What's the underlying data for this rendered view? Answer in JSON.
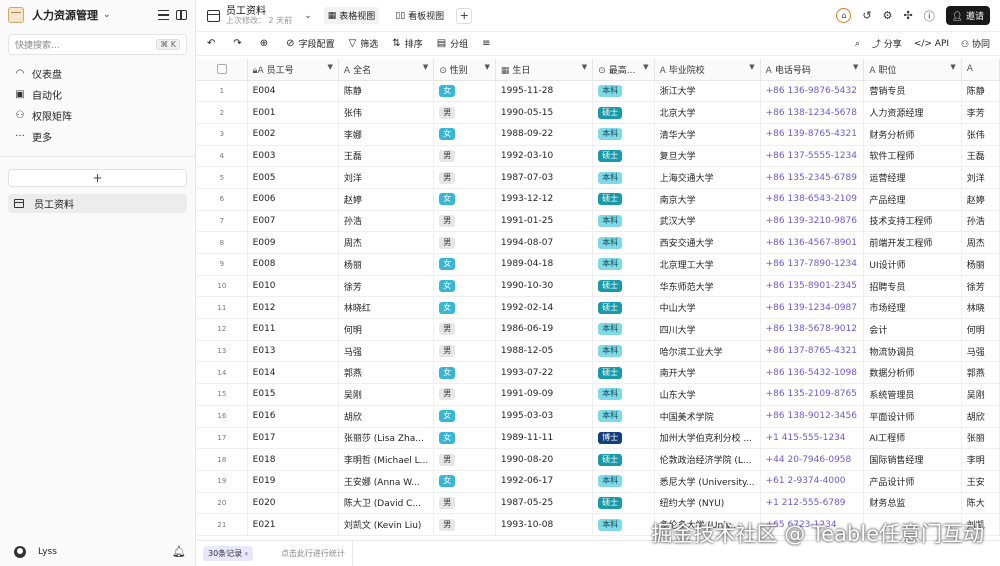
{
  "sidebar": {
    "app_title": "人力资源管理",
    "search_placeholder": "快捷搜索...",
    "search_shortcut": "⌘ K",
    "nav": [
      {
        "icon": "dashboard-icon",
        "label": "仪表盘"
      },
      {
        "icon": "automation-icon",
        "label": "自动化"
      },
      {
        "icon": "permission-icon",
        "label": "权限矩阵"
      },
      {
        "icon": "more-icon",
        "label": "更多"
      }
    ],
    "add_label": "+",
    "tables": [
      {
        "label": "员工资料"
      }
    ],
    "user_name": "Lyss"
  },
  "header": {
    "table_title": "员工资料",
    "last_modified": "上次修改： 2 天前",
    "views": [
      {
        "label": "表格视图",
        "active": true
      },
      {
        "label": "看板视图",
        "active": false
      }
    ],
    "invite_label": "邀请"
  },
  "toolbar": {
    "field_config": "字段配置",
    "filter": "筛选",
    "sort": "排序",
    "group": "分组",
    "share": "分享",
    "api": "API",
    "collab": "协同"
  },
  "columns": [
    "员工号",
    "全名",
    "性别",
    "生日",
    "最高...",
    "毕业院校",
    "电话号码",
    "职位",
    ""
  ],
  "rows": [
    {
      "n": "1",
      "id": "E004",
      "name": "陈静",
      "sex": "女",
      "birth": "1995-11-28",
      "edu": "本科",
      "school": "浙江大学",
      "phone": "+86 136-9876-5432",
      "pos": "营销专员",
      "extra": "陈静"
    },
    {
      "n": "2",
      "id": "E001",
      "name": "张伟",
      "sex": "男",
      "birth": "1990-05-15",
      "edu": "硕士",
      "school": "北京大学",
      "phone": "+86 138-1234-5678",
      "pos": "人力资源经理",
      "extra": "李芳"
    },
    {
      "n": "3",
      "id": "E002",
      "name": "李娜",
      "sex": "女",
      "birth": "1988-09-22",
      "edu": "本科",
      "school": "清华大学",
      "phone": "+86 139-8765-4321",
      "pos": "财务分析师",
      "extra": "张伟"
    },
    {
      "n": "4",
      "id": "E003",
      "name": "王磊",
      "sex": "男",
      "birth": "1992-03-10",
      "edu": "硕士",
      "school": "复旦大学",
      "phone": "+86 137-5555-1234",
      "pos": "软件工程师",
      "extra": "王磊"
    },
    {
      "n": "5",
      "id": "E005",
      "name": "刘洋",
      "sex": "男",
      "birth": "1987-07-03",
      "edu": "本科",
      "school": "上海交通大学",
      "phone": "+86 135-2345-6789",
      "pos": "运营经理",
      "extra": "刘洋"
    },
    {
      "n": "6",
      "id": "E006",
      "name": "赵婷",
      "sex": "女",
      "birth": "1993-12-12",
      "edu": "硕士",
      "school": "南京大学",
      "phone": "+86 138-6543-2109",
      "pos": "产品经理",
      "extra": "赵婷"
    },
    {
      "n": "7",
      "id": "E007",
      "name": "孙浩",
      "sex": "男",
      "birth": "1991-01-25",
      "edu": "本科",
      "school": "武汉大学",
      "phone": "+86 139-3210-9876",
      "pos": "技术支持工程师",
      "extra": "孙浩"
    },
    {
      "n": "8",
      "id": "E009",
      "name": "周杰",
      "sex": "男",
      "birth": "1994-08-07",
      "edu": "本科",
      "school": "西安交通大学",
      "phone": "+86 136-4567-8901",
      "pos": "前端开发工程师",
      "extra": "周杰"
    },
    {
      "n": "9",
      "id": "E008",
      "name": "杨丽",
      "sex": "女",
      "birth": "1989-04-18",
      "edu": "本科",
      "school": "北京理工大学",
      "phone": "+86 137-7890-1234",
      "pos": "UI设计师",
      "extra": "杨丽"
    },
    {
      "n": "10",
      "id": "E010",
      "name": "徐芳",
      "sex": "女",
      "birth": "1990-10-30",
      "edu": "硕士",
      "school": "华东师范大学",
      "phone": "+86 135-8901-2345",
      "pos": "招聘专员",
      "extra": "徐芳"
    },
    {
      "n": "11",
      "id": "E012",
      "name": "林晓红",
      "sex": "女",
      "birth": "1992-02-14",
      "edu": "硕士",
      "school": "中山大学",
      "phone": "+86 139-1234-0987",
      "pos": "市场经理",
      "extra": "林晓"
    },
    {
      "n": "12",
      "id": "E011",
      "name": "何明",
      "sex": "男",
      "birth": "1986-06-19",
      "edu": "本科",
      "school": "四川大学",
      "phone": "+86 138-5678-9012",
      "pos": "会计",
      "extra": "何明"
    },
    {
      "n": "13",
      "id": "E013",
      "name": "马强",
      "sex": "男",
      "birth": "1988-12-05",
      "edu": "本科",
      "school": "哈尔滨工业大学",
      "phone": "+86 137-8765-4321",
      "pos": "物流协调员",
      "extra": "马强"
    },
    {
      "n": "14",
      "id": "E014",
      "name": "郭燕",
      "sex": "女",
      "birth": "1993-07-22",
      "edu": "硕士",
      "school": "南开大学",
      "phone": "+86 136-5432-1098",
      "pos": "数据分析师",
      "extra": "郭燕"
    },
    {
      "n": "15",
      "id": "E015",
      "name": "吴刚",
      "sex": "男",
      "birth": "1991-09-09",
      "edu": "本科",
      "school": "山东大学",
      "phone": "+86 135-2109-8765",
      "pos": "系统管理员",
      "extra": "吴刚"
    },
    {
      "n": "16",
      "id": "E016",
      "name": "胡欣",
      "sex": "女",
      "birth": "1995-03-03",
      "edu": "本科",
      "school": "中国美术学院",
      "phone": "+86 138-9012-3456",
      "pos": "平面设计师",
      "extra": "胡欣"
    },
    {
      "n": "17",
      "id": "E017",
      "name": "张丽莎 (Lisa Zha...",
      "sex": "女",
      "birth": "1989-11-11",
      "edu": "博士",
      "school": "加州大学伯克利分校 ...",
      "phone": "+1 415-555-1234",
      "pos": "AI工程师",
      "extra": "张丽"
    },
    {
      "n": "18",
      "id": "E018",
      "name": "李明哲 (Michael L...",
      "sex": "男",
      "birth": "1990-08-20",
      "edu": "硕士",
      "school": "伦敦政治经济学院 (L...",
      "phone": "+44 20-7946-0958",
      "pos": "国际销售经理",
      "extra": "李明"
    },
    {
      "n": "19",
      "id": "E019",
      "name": "王安娜 (Anna W...",
      "sex": "女",
      "birth": "1992-06-17",
      "edu": "本科",
      "school": "悉尼大学 (University...",
      "phone": "+61 2-9374-4000",
      "pos": "产品设计师",
      "extra": "王安"
    },
    {
      "n": "20",
      "id": "E020",
      "name": "陈大卫 (David C...",
      "sex": "男",
      "birth": "1987-05-25",
      "edu": "硕士",
      "school": "纽约大学 (NYU)",
      "phone": "+1 212-555-6789",
      "pos": "财务总监",
      "extra": "陈大"
    },
    {
      "n": "21",
      "id": "E021",
      "name": "刘凯文 (Kevin Liu)",
      "sex": "男",
      "birth": "1993-10-08",
      "edu": "本科",
      "school": "多伦多大学 (Univ...",
      "phone": "+65 6723-1234",
      "pos": "",
      "extra": "刘凯"
    }
  ],
  "footer": {
    "count_label": "30条记录",
    "stat_hint": "点击此行进行统计"
  },
  "watermark": "掘金技术社区 @ Teable任意门互动"
}
